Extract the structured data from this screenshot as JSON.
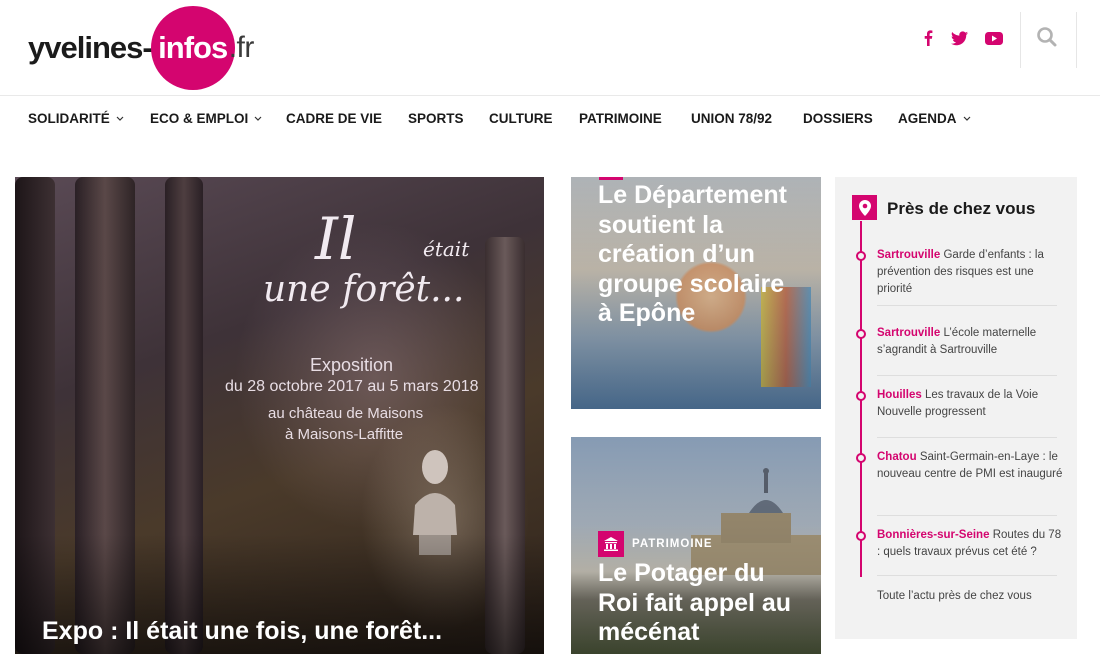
{
  "logo": {
    "part1": "yvelines",
    "dash": "-",
    "part2": "infos",
    "part3": ".fr"
  },
  "social": {
    "icons": [
      "facebook-icon",
      "twitter-icon",
      "youtube-icon"
    ],
    "search_icon": "search-icon"
  },
  "colors": {
    "brand": "#d4056f"
  },
  "nav": {
    "items": [
      {
        "label": "SOLIDARITÉ",
        "has_dropdown": true
      },
      {
        "label": "ECO & EMPLOI",
        "has_dropdown": true
      },
      {
        "label": "CADRE DE VIE",
        "has_dropdown": false
      },
      {
        "label": "SPORTS",
        "has_dropdown": false
      },
      {
        "label": "CULTURE",
        "has_dropdown": false
      },
      {
        "label": "PATRIMOINE",
        "has_dropdown": false
      },
      {
        "label": "UNION 78/92",
        "has_dropdown": false
      },
      {
        "label": "DOSSIERS",
        "has_dropdown": false
      },
      {
        "label": "AGENDA",
        "has_dropdown": true
      }
    ]
  },
  "hero": {
    "image_text": {
      "script1": "Il",
      "script2": "était",
      "script3": "une forêt...",
      "expo": "Exposition",
      "dates": "du 28 octobre 2017 au 5 mars 2018",
      "place1": "au château de Maisons",
      "place2": "à Maisons-Laffitte"
    },
    "title": "Expo : Il était une fois, une forêt..."
  },
  "card2": {
    "title": "Le Département soutient la création d’un groupe scolaire à Epône"
  },
  "card3": {
    "category": "PATRIMOINE",
    "category_icon": "monument-icon",
    "title": "Le Potager du Roi fait appel au mécénat"
  },
  "sidebar": {
    "title": "Près de chez vous",
    "icon": "map-pin-icon",
    "items": [
      {
        "city": "Sartrouville",
        "text": "Garde d’enfants : la prévention des risques est une priorité"
      },
      {
        "city": "Sartrouville",
        "text": "L’école maternelle s’agrandit à Sartrouville"
      },
      {
        "city": "Houilles",
        "text": "Les travaux de la Voie Nouvelle progressent"
      },
      {
        "city": "Chatou",
        "text": "Saint-Germain-en-Laye : le nouveau centre de PMI est inauguré"
      },
      {
        "city": "Bonnières-sur-Seine",
        "text": "Routes du 78 : quels travaux prévus cet été ?"
      }
    ],
    "more_link": "Toute l’actu près de chez vous"
  }
}
